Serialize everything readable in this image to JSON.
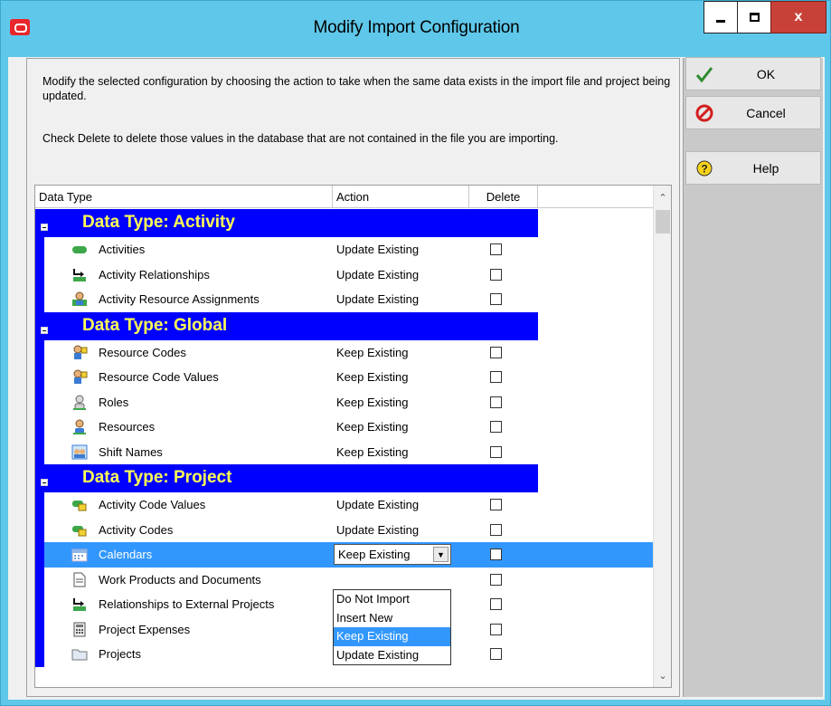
{
  "window": {
    "title": "Modify Import Configuration",
    "close_label": "x"
  },
  "instructions": {
    "line1": "Modify the selected configuration by choosing the action to take when the same data exists in the import file and project being updated.",
    "line2": "Check Delete to delete those values in the database that are not contained in the file you are importing."
  },
  "buttons": {
    "ok": "OK",
    "cancel": "Cancel",
    "help": "Help"
  },
  "grid": {
    "headers": {
      "type": "Data Type",
      "action": "Action",
      "delete": "Delete"
    },
    "groups": [
      {
        "title": "Data Type: Activity",
        "rows": [
          {
            "name": "Activities",
            "action": "Update Existing",
            "icon": "activities-icon"
          },
          {
            "name": "Activity Relationships",
            "action": "Update Existing",
            "icon": "relationship-icon"
          },
          {
            "name": "Activity Resource Assignments",
            "action": "Update Existing",
            "icon": "assignment-icon"
          }
        ]
      },
      {
        "title": "Data Type: Global",
        "rows": [
          {
            "name": "Resource Codes",
            "action": "Keep Existing",
            "icon": "resource-code-icon"
          },
          {
            "name": "Resource Code Values",
            "action": "Keep Existing",
            "icon": "resource-code-icon"
          },
          {
            "name": "Roles",
            "action": "Keep Existing",
            "icon": "role-icon"
          },
          {
            "name": "Resources",
            "action": "Keep Existing",
            "icon": "resource-icon"
          },
          {
            "name": "Shift Names",
            "action": "Keep Existing",
            "icon": "shift-icon"
          }
        ]
      },
      {
        "title": "Data Type: Project",
        "rows": [
          {
            "name": "Activity Code Values",
            "action": "Update Existing",
            "icon": "activity-code-icon"
          },
          {
            "name": "Activity Codes",
            "action": "Update Existing",
            "icon": "activity-code-icon"
          },
          {
            "name": "Calendars",
            "action": "Keep Existing",
            "icon": "calendar-icon",
            "selected": true
          },
          {
            "name": "Work Products and Documents",
            "action": "",
            "icon": "document-icon"
          },
          {
            "name": "Relationships to External Projects",
            "action": "",
            "icon": "relationship-icon"
          },
          {
            "name": "Project Expenses",
            "action": "",
            "icon": "expense-icon"
          },
          {
            "name": "Projects",
            "action": "Update Existing",
            "icon": "folder-icon"
          }
        ]
      }
    ],
    "dropdown": {
      "options": [
        "Do Not Import",
        "Insert New",
        "Keep Existing",
        "Update Existing"
      ],
      "highlighted": "Keep Existing"
    }
  },
  "colors": {
    "group_bg": "#0000ff",
    "group_text": "#ffff55",
    "selection": "#3297fd",
    "titlebar": "#5fc8ea"
  }
}
